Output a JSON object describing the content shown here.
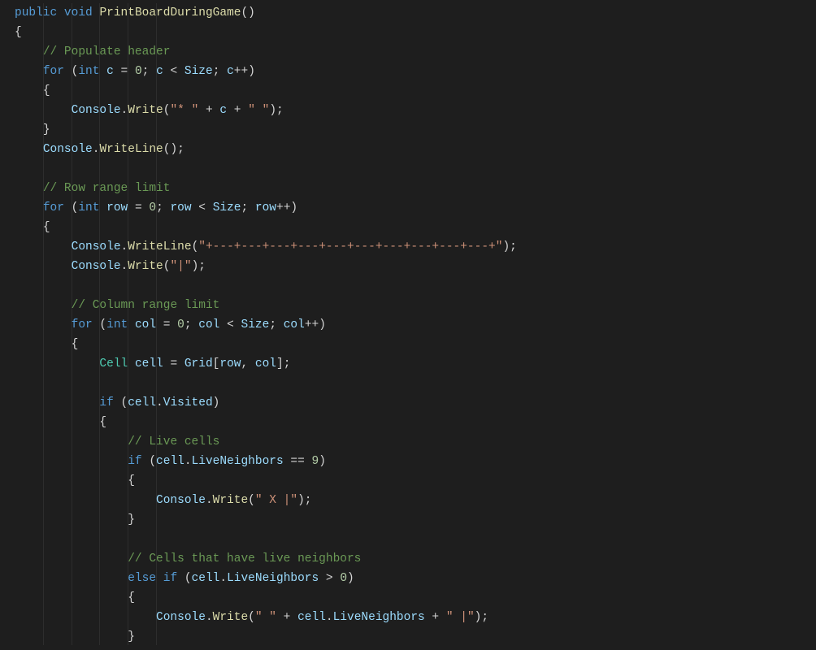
{
  "code": {
    "l1_kw_public": "public",
    "l1_kw_void": "void",
    "l1_method": "PrintBoardDuringGame",
    "l1_parens": "()",
    "l2_brace": "{",
    "l3_comment": "// Populate header",
    "l4_for": "for",
    "l4_paren_open": "(",
    "l4_int": "int",
    "l4_c": "c",
    "l4_eq": " = ",
    "l4_zero": "0",
    "l4_semi1": "; ",
    "l4_c2": "c",
    "l4_lt": " < ",
    "l4_size": "Size",
    "l4_semi2": "; ",
    "l4_c3": "c",
    "l4_inc": "++)",
    "l5_brace": "{",
    "l6_console": "Console",
    "l6_dot": ".",
    "l6_write": "Write",
    "l6_open": "(",
    "l6_str1": "\"* \"",
    "l6_plus1": " + ",
    "l6_c": "c",
    "l6_plus2": " + ",
    "l6_str2": "\" \"",
    "l6_close": ");",
    "l7_brace": "}",
    "l8_console": "Console",
    "l8_dot": ".",
    "l8_writeline": "WriteLine",
    "l8_close": "();",
    "l10_comment": "// Row range limit",
    "l11_for": "for",
    "l11_open": " (",
    "l11_int": "int",
    "l11_row": "row",
    "l11_eq": " = ",
    "l11_zero": "0",
    "l11_semi1": "; ",
    "l11_row2": "row",
    "l11_lt": " < ",
    "l11_size": "Size",
    "l11_semi2": "; ",
    "l11_row3": "row",
    "l11_inc": "++)",
    "l12_brace": "{",
    "l13_console": "Console",
    "l13_dot": ".",
    "l13_writeline": "WriteLine",
    "l13_open": "(",
    "l13_str": "\"+---+---+---+---+---+---+---+---+---+---+\"",
    "l13_close": ");",
    "l14_console": "Console",
    "l14_dot": ".",
    "l14_write": "Write",
    "l14_open": "(",
    "l14_str": "\"|\"",
    "l14_close": ");",
    "l16_comment": "// Column range limit",
    "l17_for": "for",
    "l17_open": " (",
    "l17_int": "int",
    "l17_col": "col",
    "l17_eq": " = ",
    "l17_zero": "0",
    "l17_semi1": "; ",
    "l17_col2": "col",
    "l17_lt": " < ",
    "l17_size": "Size",
    "l17_semi2": "; ",
    "l17_col3": "col",
    "l17_inc": "++)",
    "l18_brace": "{",
    "l19_cell_type": "Cell",
    "l19_cell": "cell",
    "l19_eq": " = ",
    "l19_grid": "Grid",
    "l19_br_open": "[",
    "l19_row": "row",
    "l19_comma": ", ",
    "l19_col": "col",
    "l19_br_close": "];",
    "l21_if": "if",
    "l21_open": " (",
    "l21_cell": "cell",
    "l21_dot": ".",
    "l21_visited": "Visited",
    "l21_close": ")",
    "l22_brace": "{",
    "l23_comment": "// Live cells",
    "l24_if": "if",
    "l24_open": " (",
    "l24_cell": "cell",
    "l24_dot": ".",
    "l24_ln": "LiveNeighbors",
    "l24_eq": " == ",
    "l24_nine": "9",
    "l24_close": ")",
    "l25_brace": "{",
    "l26_console": "Console",
    "l26_dot": ".",
    "l26_write": "Write",
    "l26_open": "(",
    "l26_str": "\" X |\"",
    "l26_close": ");",
    "l27_brace": "}",
    "l29_comment": "// Cells that have live neighbors",
    "l30_else": "else",
    "l30_if": "if",
    "l30_open": " (",
    "l30_cell": "cell",
    "l30_dot": ".",
    "l30_ln": "LiveNeighbors",
    "l30_gt": " > ",
    "l30_zero": "0",
    "l30_close": ")",
    "l31_brace": "{",
    "l32_console": "Console",
    "l32_dot": ".",
    "l32_write": "Write",
    "l32_open": "(",
    "l32_str1": "\" \"",
    "l32_plus1": " + ",
    "l32_cell": "cell",
    "l32_dot2": ".",
    "l32_ln": "LiveNeighbors",
    "l32_plus2": " + ",
    "l32_str2": "\" |\"",
    "l32_close": ");",
    "l33_brace": "}"
  }
}
